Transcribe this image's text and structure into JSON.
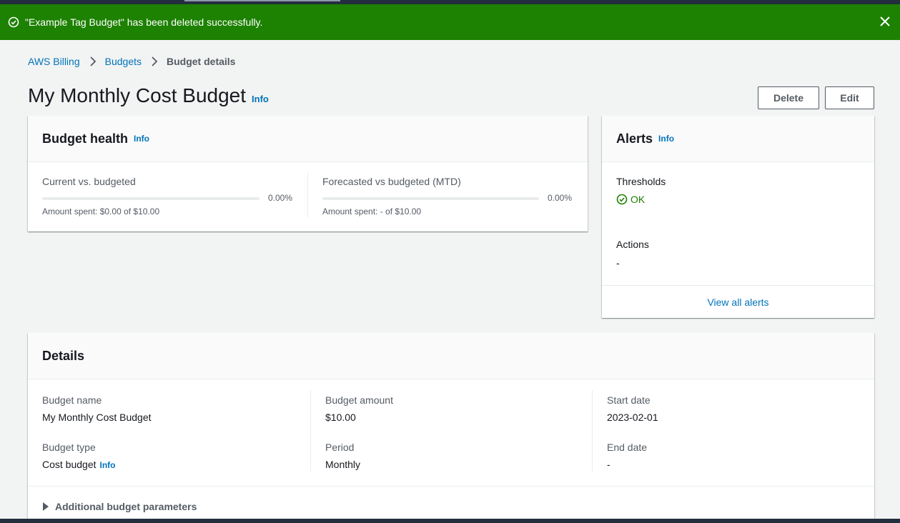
{
  "flash": {
    "message": "\"Example Tag Budget\" has been deleted successfully.",
    "status_color": "#1d8102"
  },
  "breadcrumb": {
    "items": [
      "AWS Billing",
      "Budgets"
    ],
    "current": "Budget details"
  },
  "page": {
    "title": "My Monthly Cost Budget",
    "info_label": "Info",
    "delete_label": "Delete",
    "edit_label": "Edit"
  },
  "health": {
    "title": "Budget health",
    "info_label": "Info",
    "current": {
      "label": "Current vs. budgeted",
      "percent": "0.00%",
      "progress": 0,
      "amount_text": "Amount spent: $0.00 of $10.00"
    },
    "forecast": {
      "label": "Forecasted vs budgeted (MTD)",
      "percent": "0.00%",
      "progress": 0,
      "amount_text": "Amount spent: - of $10.00"
    }
  },
  "alerts": {
    "title": "Alerts",
    "info_label": "Info",
    "thresholds_label": "Thresholds",
    "thresholds_status": "OK",
    "actions_label": "Actions",
    "actions_value": "-",
    "view_all_label": "View all alerts"
  },
  "details": {
    "title": "Details",
    "budget_name_label": "Budget name",
    "budget_name": "My Monthly Cost Budget",
    "budget_type_label": "Budget type",
    "budget_type": "Cost budget",
    "budget_type_info": "Info",
    "budget_amount_label": "Budget amount",
    "budget_amount": "$10.00",
    "period_label": "Period",
    "period": "Monthly",
    "start_date_label": "Start date",
    "start_date": "2023-02-01",
    "end_date_label": "End date",
    "end_date": "-",
    "additional_label": "Additional budget parameters"
  },
  "icons": {
    "flash": "check-circle-icon",
    "close": "close-icon",
    "breadcrumb_sep": "chevron-right-icon",
    "ok": "check-circle-icon",
    "expand": "caret-right-icon"
  },
  "colors": {
    "link": "#0073bb",
    "ok_green": "#1d8102"
  }
}
